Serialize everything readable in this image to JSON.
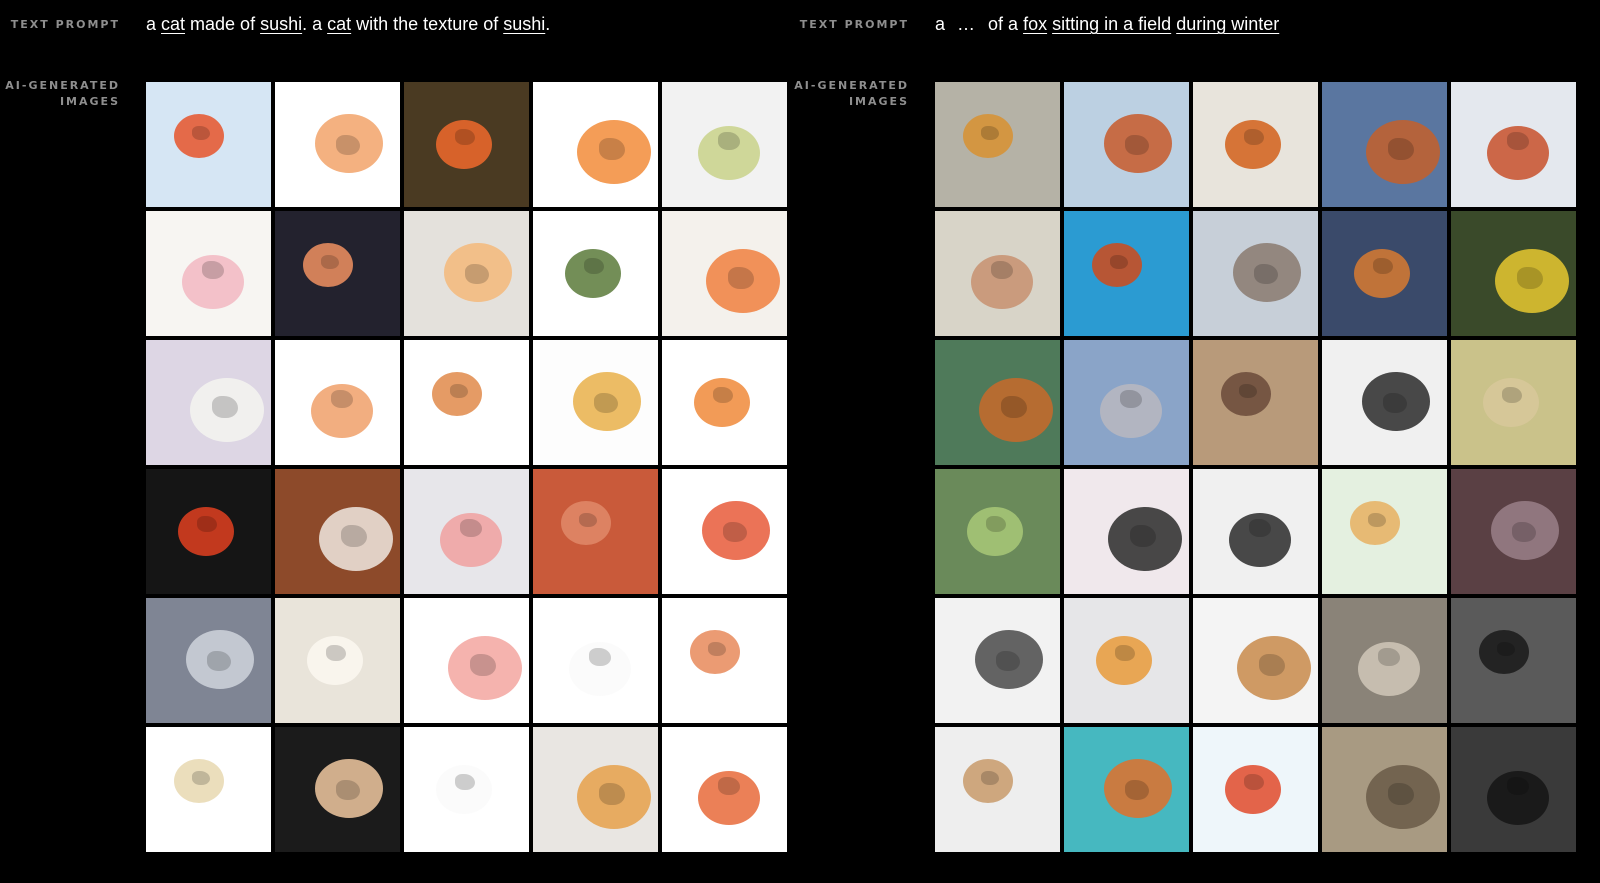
{
  "left": {
    "text_prompt_label": "TEXT PROMPT",
    "images_label_1": "AI-GENERATED",
    "images_label_2": "IMAGES",
    "prompt_tokens": [
      {
        "t": "a "
      },
      {
        "t": "cat",
        "u": true
      },
      {
        "t": " made of "
      },
      {
        "t": "sushi",
        "u": true
      },
      {
        "t": ". a "
      },
      {
        "t": "cat",
        "u": true
      },
      {
        "t": " with the texture of "
      },
      {
        "t": "sushi",
        "u": true
      },
      {
        "t": "."
      }
    ],
    "tile_colors": [
      [
        "#d6e6f4",
        "#ffffff",
        "#4a3a22",
        "#ffffff",
        "#f2f2f2"
      ],
      [
        "#f7f5f2",
        "#23222e",
        "#e4e1dc",
        "#ffffff",
        "#f4f1ec"
      ],
      [
        "#ddd6e4",
        "#ffffff",
        "#ffffff",
        "#fdfdfd",
        "#ffffff"
      ],
      [
        "#151515",
        "#8d4a2a",
        "#e7e6ea",
        "#c95a3a",
        "#ffffff"
      ],
      [
        "#7f8594",
        "#e9e4da",
        "#ffffff",
        "#ffffff",
        "#ffffff"
      ],
      [
        "#ffffff",
        "#1b1b1b",
        "#ffffff",
        "#e9e6e2",
        "#ffffff"
      ]
    ],
    "accent_colors": [
      [
        "#e6532a",
        "#f2a36a",
        "#f06a2c",
        "#f28c3a",
        "#c9d28a"
      ],
      [
        "#f2b7c2",
        "#f09060",
        "#f5b87a",
        "#5a7a3a",
        "#f08040"
      ],
      [
        "#f5f5f0",
        "#f0a06a",
        "#e08a4a",
        "#e9b04a",
        "#f08a3a"
      ],
      [
        "#e04020",
        "#f0e8e0",
        "#f0a0a0",
        "#e08a6a",
        "#e85a3a"
      ],
      [
        "#cfd3dc",
        "#fbf8f0",
        "#f3a6a0",
        "#fafafa",
        "#e88a5a"
      ],
      [
        "#e8d8b0",
        "#f0c8a0",
        "#fafafa",
        "#e6a04a",
        "#e86a3a"
      ]
    ]
  },
  "right": {
    "text_prompt_label": "TEXT PROMPT",
    "images_label_1": "AI-GENERATED",
    "images_label_2": "IMAGES",
    "prompt_tokens": [
      {
        "t": "a"
      },
      {
        "t": "…",
        "ellipsis": true
      },
      {
        "t": "of a "
      },
      {
        "t": "fox",
        "u": true
      },
      {
        "t": " "
      },
      {
        "t": "sitting in a field",
        "u": true
      },
      {
        "t": " "
      },
      {
        "t": "during winter",
        "u": true
      }
    ],
    "tile_colors": [
      [
        "#b5b2a6",
        "#bcd0e2",
        "#e8e4dc",
        "#5a76a0",
        "#e4e8ee"
      ],
      [
        "#d8d4c8",
        "#2b9bd2",
        "#c7cfd8",
        "#3a4a6a",
        "#3a4a2a"
      ],
      [
        "#4f7a5a",
        "#8aa4c8",
        "#b89a7a",
        "#f0f0f0",
        "#cac28a"
      ],
      [
        "#6a8a5a",
        "#f0e8ec",
        "#f0f0f0",
        "#e4f0e0",
        "#5a4044"
      ],
      [
        "#f2f2f2",
        "#e6e6e8",
        "#f4f4f4",
        "#8a8378",
        "#5a5a5a"
      ],
      [
        "#eeeeee",
        "#46b8c0",
        "#eef6fa",
        "#a89a82",
        "#3a3a3a"
      ]
    ],
    "accent_colors": [
      [
        "#d89030",
        "#c85a2a",
        "#d2601a",
        "#c4602a",
        "#c8502a"
      ],
      [
        "#c89070",
        "#d04a1a",
        "#8a7a70",
        "#d87a30",
        "#e8c830"
      ],
      [
        "#c86a2a",
        "#b8b8c0",
        "#6a4a3a",
        "#2a2a2a",
        "#d8c89a"
      ],
      [
        "#a8c878",
        "#2a2a2a",
        "#2a2a2a",
        "#e8b060",
        "#9a8088"
      ],
      [
        "#4a4a4a",
        "#e89a3a",
        "#c88a4a",
        "#d0c8b8",
        "#1a1a1a"
      ],
      [
        "#c89a6a",
        "#e0702a",
        "#e04a2a",
        "#6a5a48",
        "#151515"
      ]
    ]
  }
}
